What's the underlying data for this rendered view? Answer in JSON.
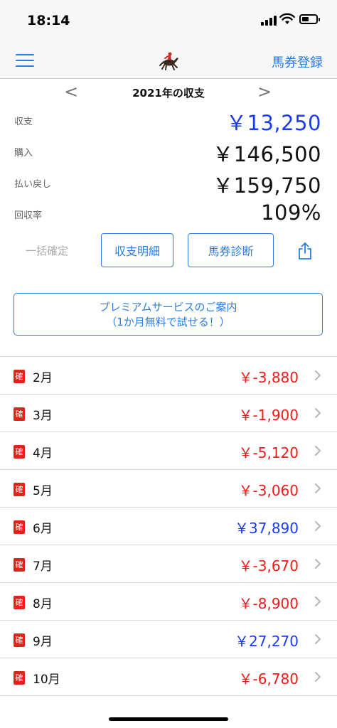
{
  "status_bar": {
    "time": "18:14"
  },
  "nav": {
    "register_label": "馬券登録"
  },
  "year_header": {
    "prev": "<",
    "title": "2021年の収支",
    "next": ">"
  },
  "summary": [
    {
      "label": "収支",
      "value": "￥13,250",
      "color": "#1a3cf5"
    },
    {
      "label": "購入",
      "value": "￥146,500",
      "color": "#111111"
    },
    {
      "label": "払い戻し",
      "value": "￥159,750",
      "color": "#111111"
    },
    {
      "label": "回収率",
      "value": "109%",
      "color": "#111111"
    }
  ],
  "actions": {
    "bulk_confirm": "一括確定",
    "detail_button": "収支明細",
    "diagnosis_button": "馬券診断"
  },
  "premium": {
    "line1": "プレミアムサービスのご案内",
    "line2": "（1か月無料で試せる！）"
  },
  "months": [
    {
      "badge": "確",
      "month": "2月",
      "amount": "￥-3,880",
      "sign": "neg"
    },
    {
      "badge": "確",
      "month": "3月",
      "amount": "￥-1,900",
      "sign": "neg"
    },
    {
      "badge": "確",
      "month": "4月",
      "amount": "￥-5,120",
      "sign": "neg"
    },
    {
      "badge": "確",
      "month": "5月",
      "amount": "￥-3,060",
      "sign": "neg"
    },
    {
      "badge": "確",
      "month": "6月",
      "amount": "￥37,890",
      "sign": "pos"
    },
    {
      "badge": "確",
      "month": "7月",
      "amount": "￥-3,670",
      "sign": "neg"
    },
    {
      "badge": "確",
      "month": "8月",
      "amount": "￥-8,900",
      "sign": "neg"
    },
    {
      "badge": "確",
      "month": "9月",
      "amount": "￥27,270",
      "sign": "pos"
    },
    {
      "badge": "確",
      "month": "10月",
      "amount": "￥-6,780",
      "sign": "neg"
    }
  ],
  "colors": {
    "accent": "#2a7de1",
    "negative": "#ef1b1b",
    "positive": "#1a3cf5",
    "badge": "#e0241b"
  }
}
